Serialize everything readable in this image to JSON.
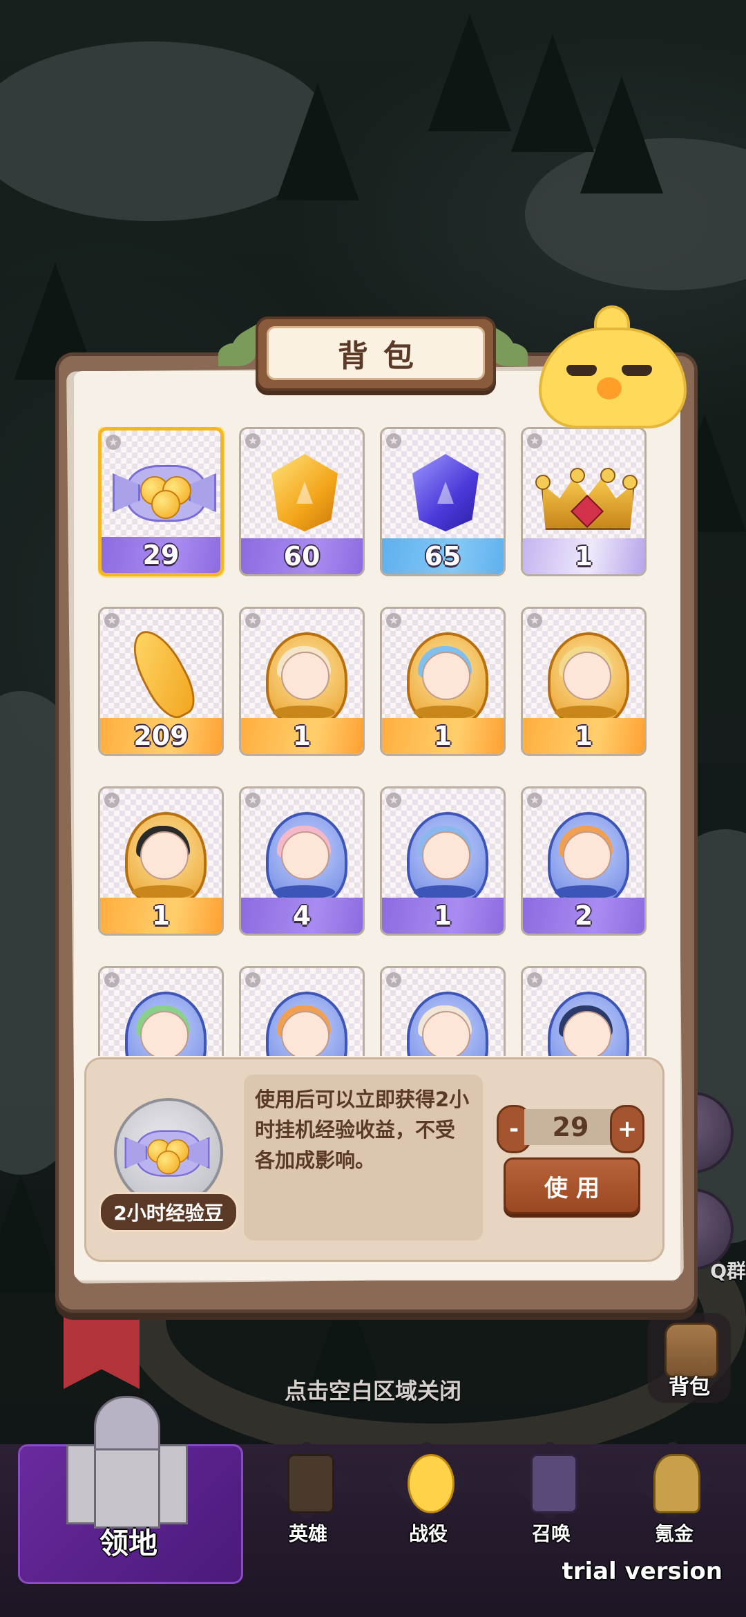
{
  "panel": {
    "title": "背包"
  },
  "grid_items": [
    {
      "count": "29",
      "icon": "candy-icon",
      "rarity": "purple",
      "selected": true
    },
    {
      "count": "60",
      "icon": "gold-crystal-icon",
      "rarity": "purple"
    },
    {
      "count": "65",
      "icon": "blue-crystal-icon",
      "rarity": "blue"
    },
    {
      "count": "1",
      "icon": "crown-icon",
      "rarity": "pastel"
    },
    {
      "count": "209",
      "icon": "feather-icon",
      "rarity": "orange"
    },
    {
      "count": "1",
      "icon": "hero-shard-icon",
      "rarity": "orange"
    },
    {
      "count": "1",
      "icon": "hero-shard-icon",
      "rarity": "orange"
    },
    {
      "count": "1",
      "icon": "hero-shard-icon",
      "rarity": "orange"
    },
    {
      "count": "1",
      "icon": "hero-shard-icon",
      "rarity": "orange"
    },
    {
      "count": "4",
      "icon": "hero-shard-icon",
      "rarity": "purple"
    },
    {
      "count": "1",
      "icon": "hero-shard-icon",
      "rarity": "purple"
    },
    {
      "count": "2",
      "icon": "hero-shard-icon",
      "rarity": "purple"
    },
    {
      "count": "",
      "icon": "hero-shard-icon",
      "rarity": "purple"
    },
    {
      "count": "",
      "icon": "hero-shard-icon",
      "rarity": "purple"
    },
    {
      "count": "",
      "icon": "hero-shard-icon",
      "rarity": "purple"
    },
    {
      "count": "",
      "icon": "hero-shard-icon",
      "rarity": "purple"
    }
  ],
  "detail": {
    "item_name": "2小时经验豆",
    "description": "使用后可以立即获得2小时挂机经验收益，不受各加成影响。",
    "quantity": "29",
    "minus_label": "-",
    "plus_label": "+",
    "use_label": "使用"
  },
  "close_hint": "点击空白区域关闭",
  "side": {
    "bag_label": "背包",
    "group_label": "Q群"
  },
  "nav": {
    "home": "领地",
    "heroes": "英雄",
    "battle": "战役",
    "summon": "召唤",
    "shop": "氪金"
  },
  "watermark": "trial version",
  "colors": {
    "panel_brown": "#8a6a55",
    "paper": "#f6f0e6",
    "accent_gold": "#f3b722",
    "use_button": "#a4552f",
    "nav_bg": "#2d2036"
  }
}
